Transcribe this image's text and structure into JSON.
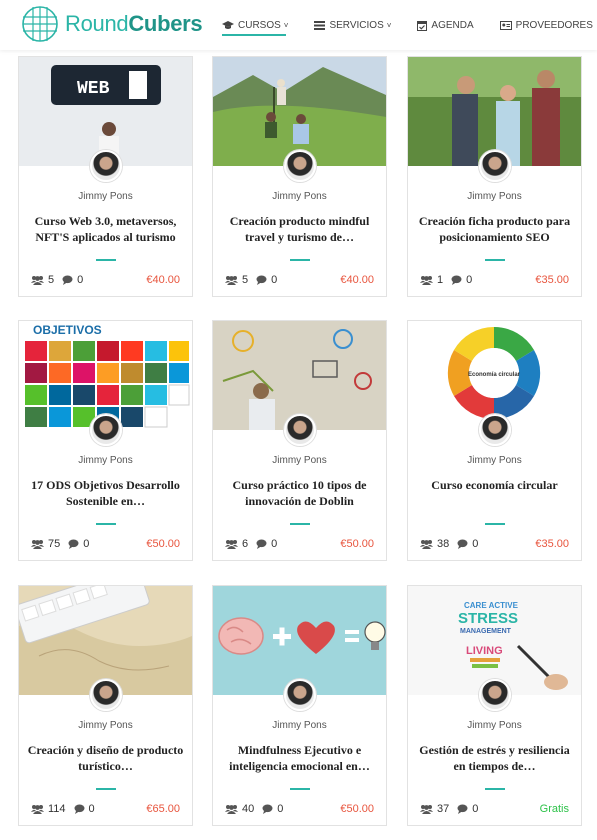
{
  "header": {
    "logo": {
      "part1": "Round",
      "part2": "Cubers"
    },
    "nav": [
      {
        "label": "CURSOS",
        "icon": "graduation-cap-icon",
        "has_dropdown": true,
        "active": true
      },
      {
        "label": "SERVICIOS",
        "icon": "list-icon",
        "has_dropdown": true,
        "active": false
      },
      {
        "label": "AGENDA",
        "icon": "calendar-check-icon",
        "has_dropdown": false,
        "active": false
      },
      {
        "label": "PROVEEDORES",
        "icon": "id-card-icon",
        "has_dropdown": false,
        "active": false
      }
    ]
  },
  "courses": [
    {
      "author": "Jimmy Pons",
      "title": "Curso Web 3.0, metaversos, NFT'S aplicados al turismo",
      "students": "5",
      "comments": "0",
      "price": "€40.00",
      "image": "web3-sign"
    },
    {
      "author": "Jimmy Pons",
      "title": "Creación producto mindful travel y turismo de…",
      "students": "5",
      "comments": "0",
      "price": "€40.00",
      "image": "meadow-people"
    },
    {
      "author": "Jimmy Pons",
      "title": "Creación ficha producto para posicionamiento SEO",
      "students": "1",
      "comments": "0",
      "price": "€35.00",
      "image": "vineyard-toast"
    },
    {
      "author": "Jimmy Pons",
      "title": "17 ODS Objetivos Desarrollo Sostenible en…",
      "students": "75",
      "comments": "0",
      "price": "€50.00",
      "image": "sdg-grid"
    },
    {
      "author": "Jimmy Pons",
      "title": "Curso práctico 10 tipos de innovación de Doblin",
      "students": "6",
      "comments": "0",
      "price": "€50.00",
      "image": "innovation-doodles"
    },
    {
      "author": "Jimmy Pons",
      "title": "Curso economía circular",
      "students": "38",
      "comments": "0",
      "price": "€35.00",
      "image": "circular-economy"
    },
    {
      "author": "Jimmy Pons",
      "title": "Creación y diseño de producto turístico…",
      "students": "114",
      "comments": "0",
      "price": "€65.00",
      "image": "map-keyboard"
    },
    {
      "author": "Jimmy Pons",
      "title": "Mindfulness Ejecutivo e inteligencia emocional en…",
      "students": "40",
      "comments": "0",
      "price": "€50.00",
      "image": "brain-heart-bulb"
    },
    {
      "author": "Jimmy Pons",
      "title": "Gestión de estrés y resiliencia en tiempos de…",
      "students": "37",
      "comments": "0",
      "price": "Gratis",
      "image": "stress-bulb"
    }
  ],
  "image_text": {
    "web3": "WEB",
    "sdg": "OBJETIVOS",
    "circular": "Economía circular",
    "stress_1": "CARE ACTIVE",
    "stress_2": "STRESS",
    "stress_3": "MANAGEMENT",
    "stress_4": "LIVING"
  },
  "colors": {
    "accent": "#2bb5a7",
    "price": "#e8553e",
    "free": "#2ec24a"
  }
}
